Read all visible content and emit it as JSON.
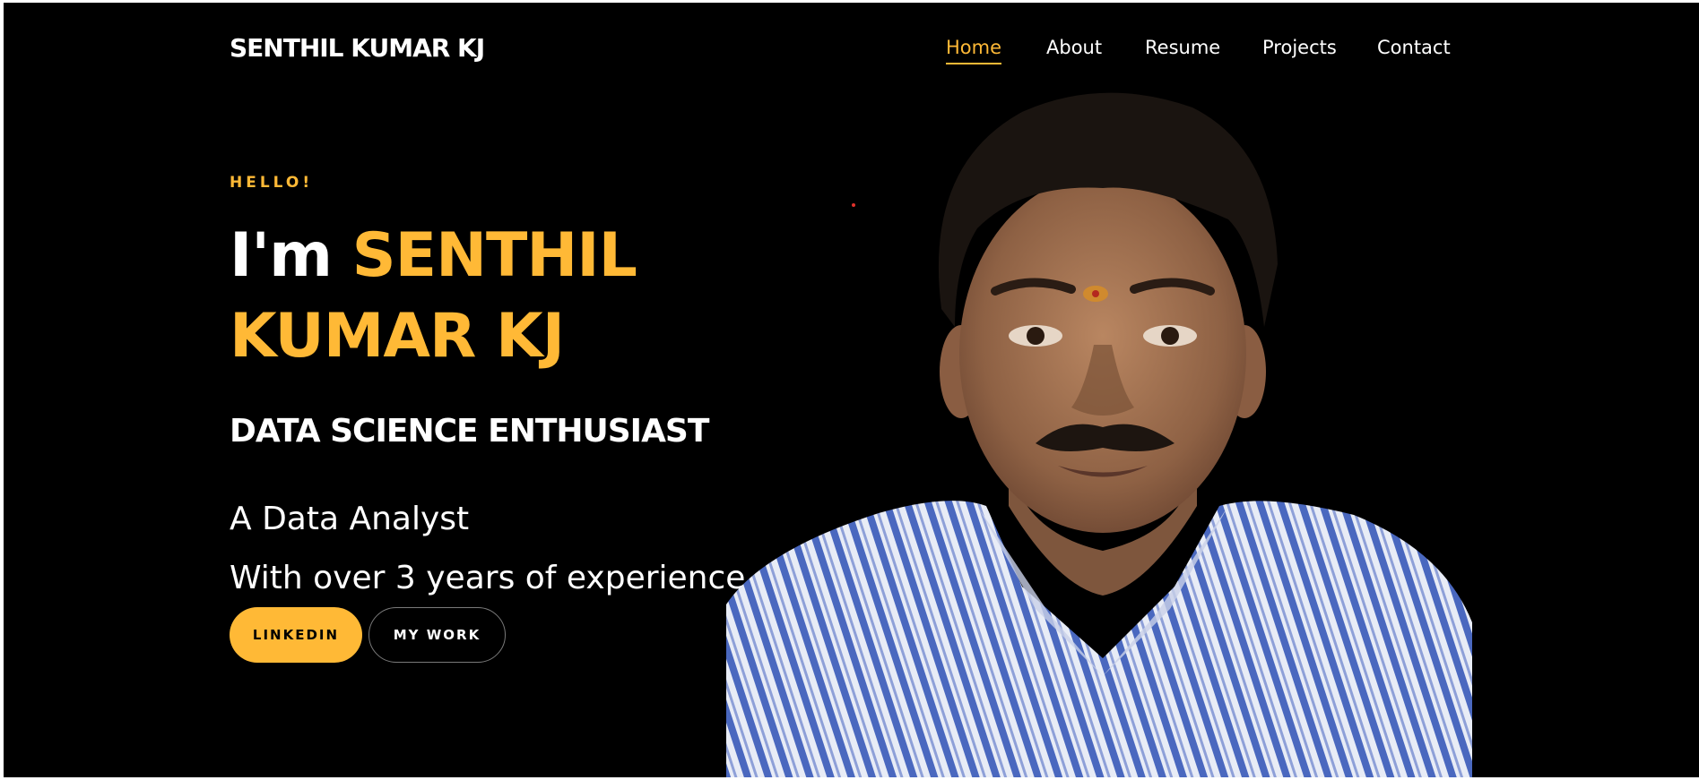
{
  "brand": "SENTHIL KUMAR KJ",
  "nav": {
    "items": [
      {
        "label": "Home",
        "active": true
      },
      {
        "label": "About",
        "active": false
      },
      {
        "label": "Resume",
        "active": false
      },
      {
        "label": "Projects",
        "active": false
      },
      {
        "label": "Contact",
        "active": false
      }
    ]
  },
  "hero": {
    "greeting": "HELLO!",
    "intro": "I'm ",
    "name": "SENTHIL KUMAR KJ",
    "role": "DATA SCIENCE ENTHUSIAST",
    "line1": "A Data Analyst",
    "line2": "With over 3 years of experience",
    "buttons": {
      "primary": "LINKEDIN",
      "secondary": "MY WORK"
    }
  },
  "colors": {
    "accent": "#ffb936",
    "background": "#000000",
    "text": "#ffffff"
  },
  "icons": {
    "portrait": "portrait-photo"
  }
}
